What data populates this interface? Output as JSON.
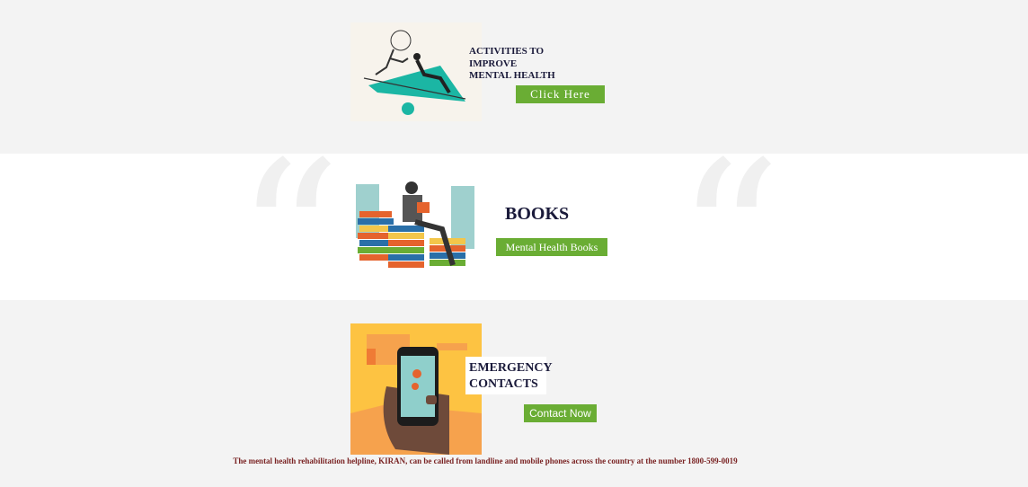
{
  "activities": {
    "title_line1": "ACTIVITIES TO",
    "title_line2": "IMPROVE",
    "title_line3": "MENTAL HEALTH",
    "button_label": "Click Here"
  },
  "books": {
    "title": "BOOKS",
    "button_label": "Mental Health Books"
  },
  "emergency": {
    "title_line1": "EMERGENCY",
    "title_line2": "CONTACTS",
    "button_label": "Contact Now"
  },
  "footer": {
    "helpline_text": "The mental health rehabilitation helpline, KIRAN, can be called from landline and mobile phones across the country at the number 1800-599-0019"
  },
  "colors": {
    "button_green": "#6aad34",
    "title_navy": "#1a1a3a",
    "helpline_red": "#7a2424"
  }
}
